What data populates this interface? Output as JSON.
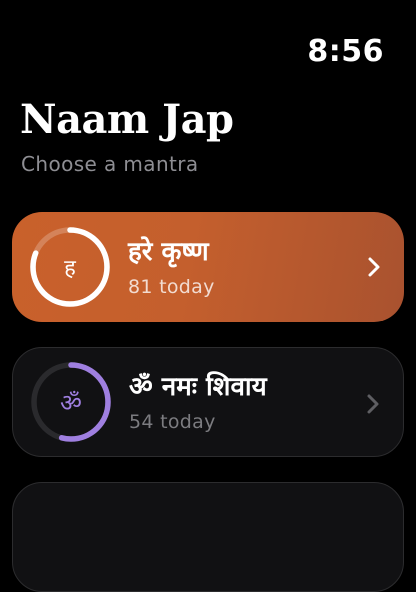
{
  "status": {
    "time": "8:56"
  },
  "header": {
    "title": "Naam Jap",
    "subtitle": "Choose a mantra"
  },
  "mantras": [
    {
      "glyph": "ह",
      "name": "हरे कृष्ण",
      "count_label": "81 today",
      "progress": 0.81,
      "selected": true,
      "ring_color": "#ffffff",
      "icon": "chevron-right-icon"
    },
    {
      "glyph": "ॐ",
      "name": "ॐ नमः शिवाय",
      "count_label": "54 today",
      "progress": 0.54,
      "selected": false,
      "ring_color": "#9f7fe0",
      "icon": "chevron-right-icon"
    }
  ],
  "colors": {
    "accent": "#c9612b",
    "ring_secondary": "#9f7fe0",
    "background": "#000000"
  }
}
